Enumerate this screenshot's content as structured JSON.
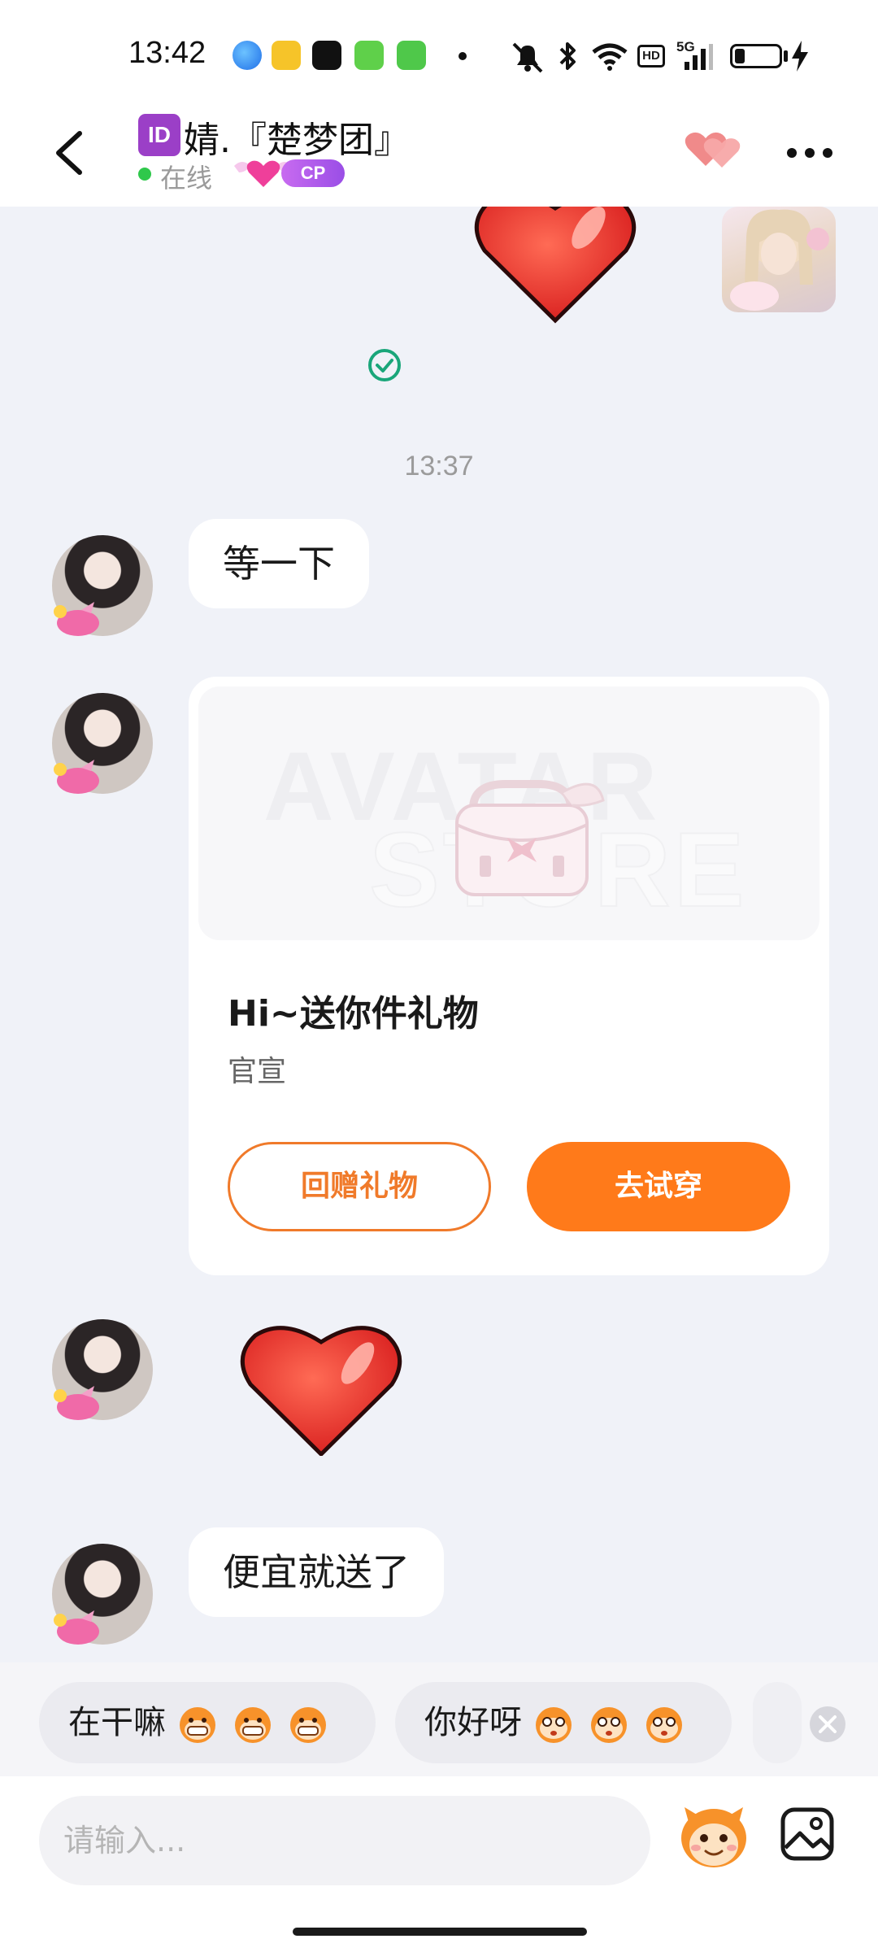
{
  "status_bar": {
    "time": "13:42",
    "icons": [
      "browser-icon",
      "app-yellow-icon",
      "tiktok-icon",
      "app-green-icon",
      "messages-icon",
      "dot-icon",
      "mute-icon",
      "bluetooth-icon",
      "wifi-icon",
      "hd-icon",
      "signal-5g-icon",
      "battery-icon",
      "charging-icon"
    ],
    "hd_label": "HD",
    "network_label": "5G"
  },
  "header": {
    "id_badge": "ID",
    "contact_name": "婧.『楚梦团』",
    "online_status": "在线",
    "cp_label": "CP",
    "accent": "#9a4ee6"
  },
  "chat": {
    "timestamp": "13:37",
    "messages": [
      {
        "type": "text",
        "text": "等一下"
      },
      {
        "type": "gift_card",
        "title": "Hi~送你件礼物",
        "subtitle": "官宣",
        "image_text_1": "AVATAR",
        "image_text_2": "STORE",
        "secondary_button": "回赠礼物",
        "primary_button": "去试穿"
      },
      {
        "type": "sticker",
        "icon": "heart-sticker-icon"
      },
      {
        "type": "text",
        "text": "便宜就送了"
      }
    ]
  },
  "quick_replies": [
    {
      "label": "在干嘛"
    },
    {
      "label": "你好呀"
    }
  ],
  "input": {
    "placeholder": "请输入..."
  },
  "colors": {
    "brand_orange": "#ff7a1a",
    "online_green": "#2fc84b",
    "read_check": "#1aa67a"
  }
}
